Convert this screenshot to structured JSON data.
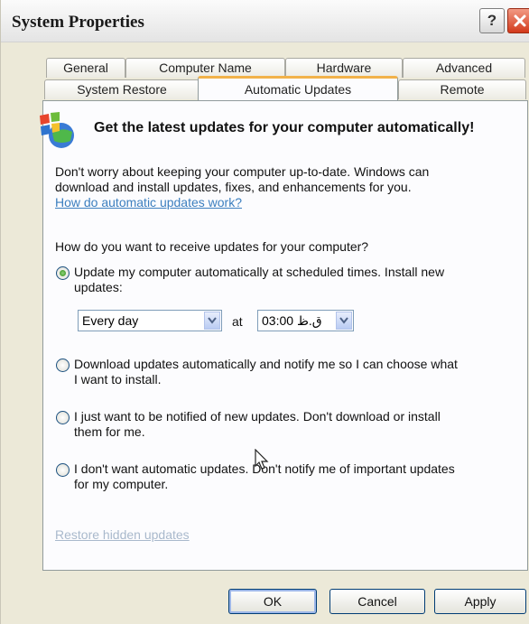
{
  "window": {
    "title": "System Properties",
    "help_label": "?"
  },
  "tabs_row1": [
    "General",
    "Computer Name",
    "Hardware",
    "Advanced"
  ],
  "tabs_row2": [
    "System Restore",
    "Automatic Updates",
    "Remote"
  ],
  "active_tab": "Automatic Updates",
  "panel": {
    "heading": "Get the latest updates for your computer automatically!",
    "intro_line1": "Don't worry about keeping your computer up-to-date. Windows can",
    "intro_line2": "download and install updates, fixes, and enhancements for you.",
    "how_link": "How do automatic updates work?",
    "question": "How do you want to receive updates for your computer?",
    "options": [
      {
        "line1": "Update my computer automatically at scheduled times. Install new",
        "line2": "updates:",
        "selected": true
      },
      {
        "line1": "Download updates automatically and notify me so I can choose what",
        "line2": "I want to install.",
        "selected": false
      },
      {
        "line1": "I just want to be notified of new updates. Don't download or install",
        "line2": "them for me.",
        "selected": false
      },
      {
        "line1": "I don't want automatic updates. Don't notify me of important updates",
        "line2": "for my computer.",
        "selected": false
      }
    ],
    "schedule_day": "Every day",
    "at_label": "at",
    "schedule_time": "03:00 ق.ظ",
    "restore_link": "Restore hidden updates"
  },
  "buttons": {
    "ok": "OK",
    "cancel": "Cancel",
    "apply": "Apply"
  },
  "colors": {
    "active_tab_accent": "#f2b24a",
    "link": "#3c7fbf",
    "close_button": "#d2391b"
  }
}
